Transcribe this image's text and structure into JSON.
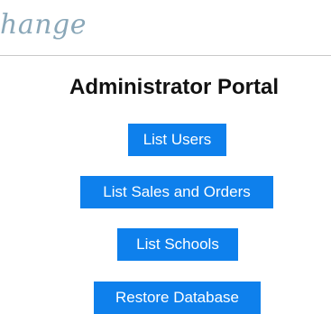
{
  "header": {
    "logo_text": "hange"
  },
  "main": {
    "title": "Administrator Portal",
    "buttons": {
      "list_users": "List Users",
      "list_sales_orders": "List Sales and Orders",
      "list_schools": "List Schools",
      "restore_database": "Restore Database"
    }
  },
  "colors": {
    "button_bg": "#0e80ec",
    "button_text": "#ffffff",
    "logo": "#8aa7b8",
    "divider": "#c9c9c9"
  }
}
